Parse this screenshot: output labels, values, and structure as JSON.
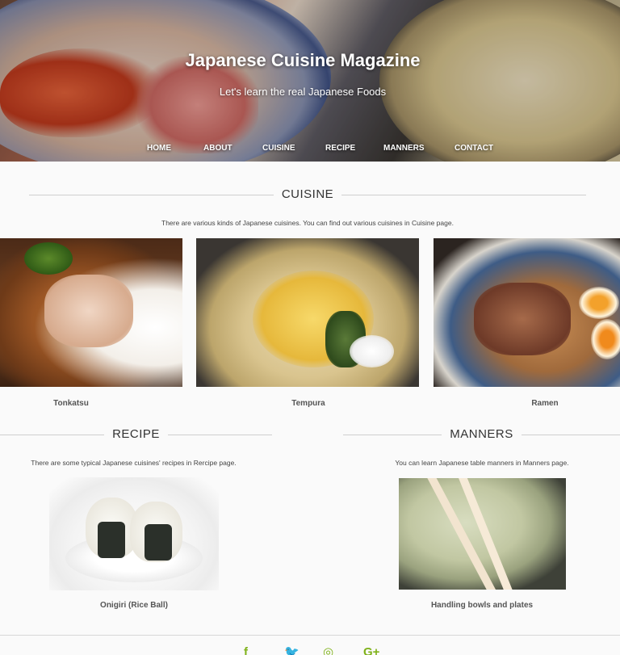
{
  "header": {
    "title": "Japanese Cuisine Magazine",
    "subtitle": "Let's learn the real Japanese Foods"
  },
  "nav": {
    "items": [
      "HOME",
      "ABOUT",
      "CUISINE",
      "RECIPE",
      "MANNERS",
      "CONTACT"
    ]
  },
  "cuisine": {
    "heading": "CUISINE",
    "description": "There are various kinds of Japanese cuisines. You can find out various cuisines in Cuisine page.",
    "items": [
      {
        "caption": "Tonkatsu"
      },
      {
        "caption": "Tempura"
      },
      {
        "caption": "Ramen"
      }
    ]
  },
  "recipe": {
    "heading": "RECIPE",
    "description": "There are some typical Japanese cuisines' recipes in Rercipe page.",
    "caption": "Onigiri (Rice Ball)"
  },
  "manners": {
    "heading": "MANNERS",
    "description": "You can learn Japanese table manners in Manners page.",
    "caption": "Handling bowls and plates"
  },
  "social": {
    "icons": [
      "facebook-icon",
      "twitter-icon",
      "instagram-icon",
      "google-plus-icon"
    ],
    "color": "#7fb21a"
  }
}
